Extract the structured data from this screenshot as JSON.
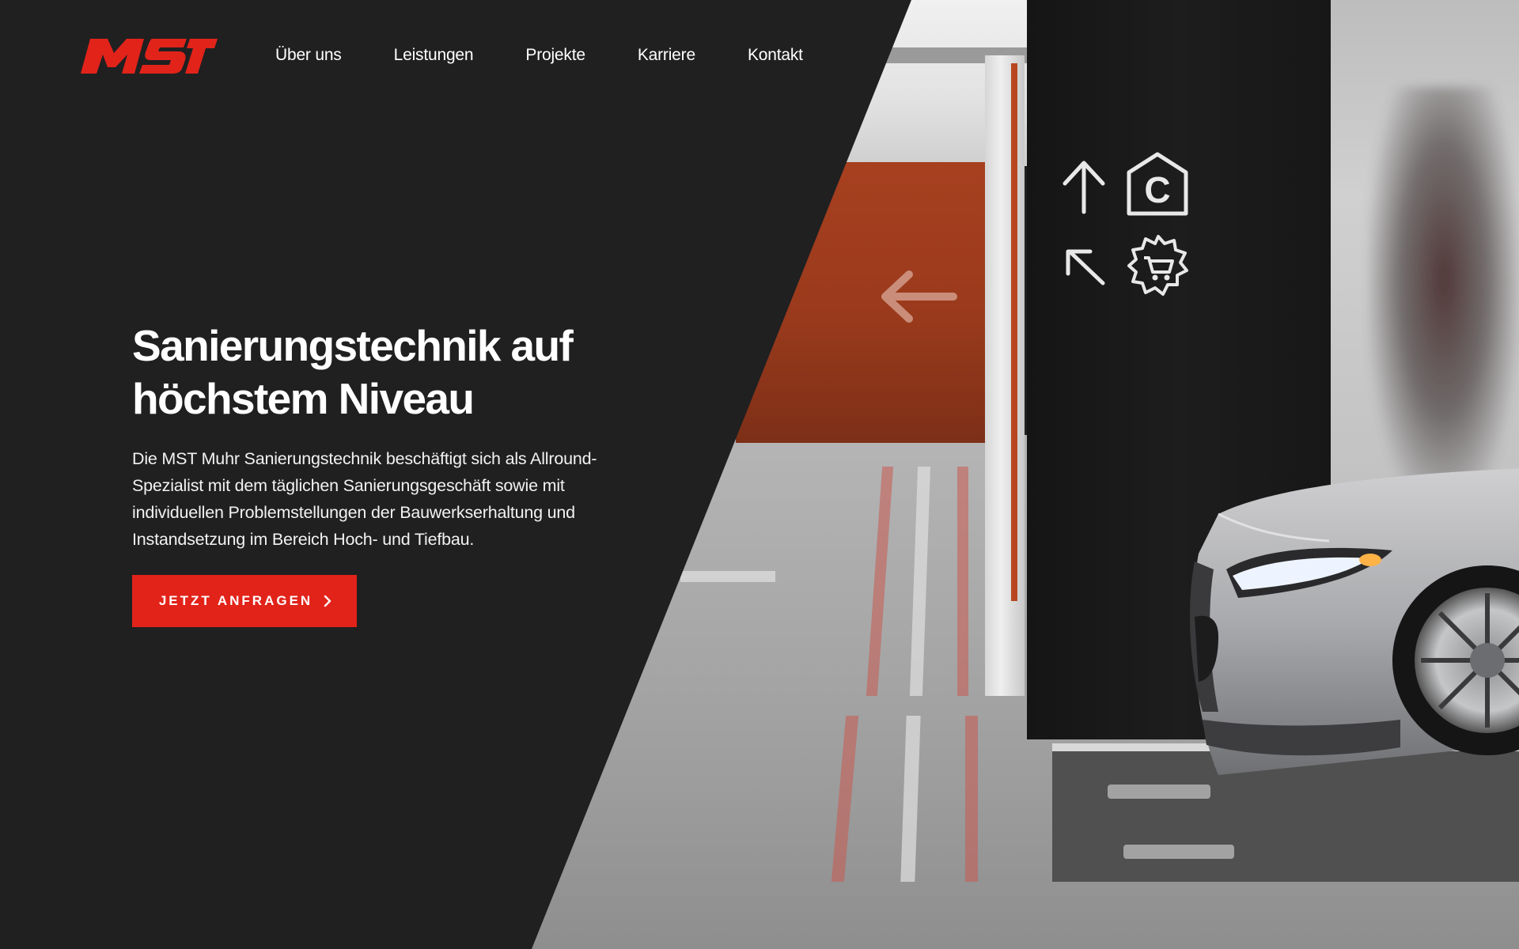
{
  "brand": {
    "logo_text": "MST",
    "accent_color": "#e2231a",
    "panel_color": "#202021"
  },
  "nav": {
    "items": [
      {
        "label": "Über uns"
      },
      {
        "label": "Leistungen"
      },
      {
        "label": "Projekte"
      },
      {
        "label": "Karriere"
      },
      {
        "label": "Kontakt"
      }
    ]
  },
  "hero": {
    "title_line1": "Sanierungstechnik auf",
    "title_line2": "höchstem Niveau",
    "text": "Die MST Muhr Sanierungstechnik beschäftigt sich als Allround-Spezialist mit dem täglichen Sanierungsgeschäft sowie mit individuellen Problemstellungen der Bauwerkserhaltung und Instandsetzung im Bereich Hoch- und Tiefbau.",
    "cta_label": "JETZT ANFRAGEN",
    "cta_icon": "chevron-right-icon"
  },
  "photo": {
    "signs": [
      "arrow-up-icon",
      "parking-c-icon",
      "arrow-up-left-icon",
      "shopping-cart-icon",
      "arrow-left-icon"
    ]
  }
}
